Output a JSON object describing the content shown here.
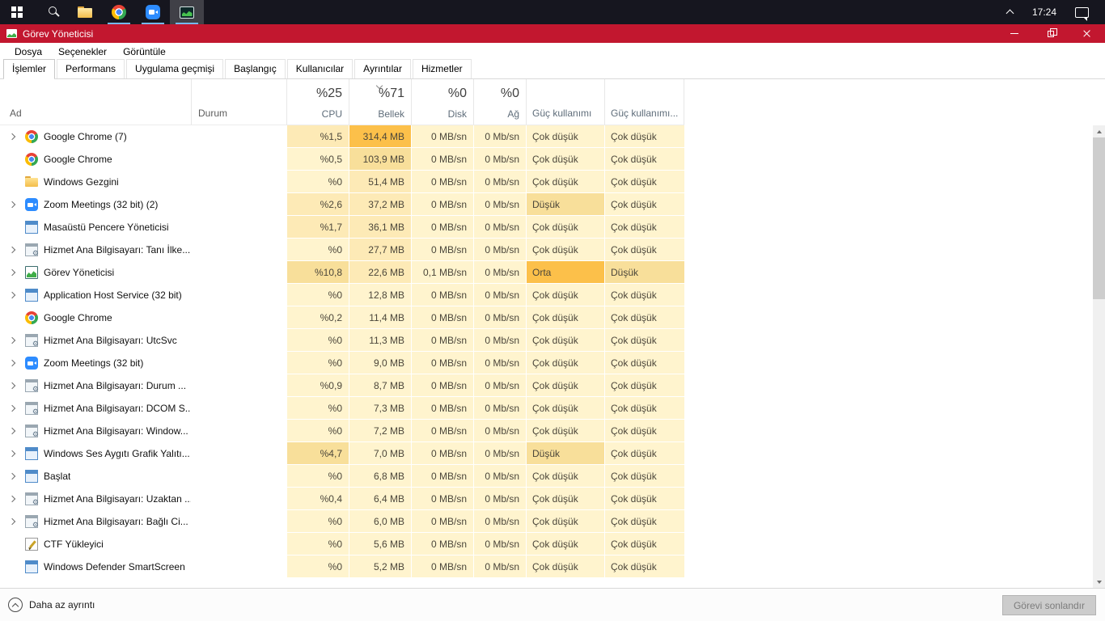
{
  "colors": {
    "taskbar_bg": "#16161f",
    "titlebar_bg": "#c2172f",
    "underline": "#76b9ed",
    "heat": [
      "#fff4ce",
      "#fdeab6",
      "#f8df9a",
      "#f5d172",
      "#fcc04a"
    ]
  },
  "taskbar": {
    "time": "17:24",
    "icons": [
      "start",
      "search",
      "file-explorer",
      "chrome",
      "zoom",
      "task-manager"
    ],
    "active_icon": "task-manager"
  },
  "titlebar": {
    "title": "Görev Yöneticisi"
  },
  "menubar": {
    "items": [
      "Dosya",
      "Seçenekler",
      "Görüntüle"
    ]
  },
  "tabs": {
    "items": [
      "İşlemler",
      "Performans",
      "Uygulama geçmişi",
      "Başlangıç",
      "Kullanıcılar",
      "Ayrıntılar",
      "Hizmetler"
    ],
    "active": "İşlemler"
  },
  "table": {
    "columns": {
      "name": "Ad",
      "status": "Durum",
      "cpu": {
        "pct": "%25",
        "label": "CPU"
      },
      "memory": {
        "pct": "%71",
        "label": "Bellek",
        "sorted": "desc"
      },
      "disk": {
        "pct": "%0",
        "label": "Disk"
      },
      "network": {
        "pct": "%0",
        "label": "Ağ"
      },
      "power": {
        "label": "Güç kullanımı"
      },
      "power_trend": {
        "label": "Güç kullanımı..."
      }
    },
    "rows": [
      {
        "name": "Google Chrome (7)",
        "icon": "chrome",
        "expand": true,
        "status": "",
        "cpu": "%1,5",
        "memory": "314,4 MB",
        "disk": "0 MB/sn",
        "network": "0 Mb/sn",
        "power": "Çok düşük",
        "trend": "Çok düşük",
        "heat": [
          1,
          4,
          0,
          0,
          0,
          0
        ]
      },
      {
        "name": "Google Chrome",
        "icon": "chrome",
        "expand": false,
        "status": "",
        "cpu": "%0,5",
        "memory": "103,9 MB",
        "disk": "0 MB/sn",
        "network": "0 Mb/sn",
        "power": "Çok düşük",
        "trend": "Çok düşük",
        "heat": [
          0,
          2,
          0,
          0,
          0,
          0
        ]
      },
      {
        "name": "Windows Gezgini",
        "icon": "folder",
        "expand": false,
        "status": "",
        "cpu": "%0",
        "memory": "51,4 MB",
        "disk": "0 MB/sn",
        "network": "0 Mb/sn",
        "power": "Çok düşük",
        "trend": "Çok düşük",
        "heat": [
          0,
          1,
          0,
          0,
          0,
          0
        ]
      },
      {
        "name": "Zoom Meetings (32 bit) (2)",
        "icon": "zoom",
        "expand": true,
        "status": "",
        "cpu": "%2,6",
        "memory": "37,2 MB",
        "disk": "0 MB/sn",
        "network": "0 Mb/sn",
        "power": "Düşük",
        "trend": "Çok düşük",
        "heat": [
          1,
          1,
          0,
          0,
          2,
          0
        ]
      },
      {
        "name": "Masaüstü Pencere Yöneticisi",
        "icon": "window",
        "expand": false,
        "status": "",
        "cpu": "%1,7",
        "memory": "36,1 MB",
        "disk": "0 MB/sn",
        "network": "0 Mb/sn",
        "power": "Çok düşük",
        "trend": "Çok düşük",
        "heat": [
          1,
          1,
          0,
          0,
          0,
          0
        ]
      },
      {
        "name": "Hizmet Ana Bilgisayarı: Tanı İlke...",
        "icon": "svchost",
        "expand": true,
        "status": "",
        "cpu": "%0",
        "memory": "27,7 MB",
        "disk": "0 MB/sn",
        "network": "0 Mb/sn",
        "power": "Çok düşük",
        "trend": "Çok düşük",
        "heat": [
          0,
          1,
          0,
          0,
          0,
          0
        ]
      },
      {
        "name": "Görev Yöneticisi",
        "icon": "taskmgr",
        "expand": true,
        "status": "",
        "cpu": "%10,8",
        "memory": "22,6 MB",
        "disk": "0,1 MB/sn",
        "network": "0 Mb/sn",
        "power": "Orta",
        "trend": "Düşük",
        "heat": [
          2,
          1,
          0,
          0,
          4,
          2
        ]
      },
      {
        "name": "Application Host Service (32 bit)",
        "icon": "window",
        "expand": true,
        "status": "",
        "cpu": "%0",
        "memory": "12,8 MB",
        "disk": "0 MB/sn",
        "network": "0 Mb/sn",
        "power": "Çok düşük",
        "trend": "Çok düşük",
        "heat": [
          0,
          0,
          0,
          0,
          0,
          0
        ]
      },
      {
        "name": "Google Chrome",
        "icon": "chrome",
        "expand": false,
        "status": "",
        "cpu": "%0,2",
        "memory": "11,4 MB",
        "disk": "0 MB/sn",
        "network": "0 Mb/sn",
        "power": "Çok düşük",
        "trend": "Çok düşük",
        "heat": [
          0,
          0,
          0,
          0,
          0,
          0
        ]
      },
      {
        "name": "Hizmet Ana Bilgisayarı: UtcSvc",
        "icon": "svchost",
        "expand": true,
        "status": "",
        "cpu": "%0",
        "memory": "11,3 MB",
        "disk": "0 MB/sn",
        "network": "0 Mb/sn",
        "power": "Çok düşük",
        "trend": "Çok düşük",
        "heat": [
          0,
          0,
          0,
          0,
          0,
          0
        ]
      },
      {
        "name": "Zoom Meetings (32 bit)",
        "icon": "zoom",
        "expand": true,
        "status": "",
        "cpu": "%0",
        "memory": "9,0 MB",
        "disk": "0 MB/sn",
        "network": "0 Mb/sn",
        "power": "Çok düşük",
        "trend": "Çok düşük",
        "heat": [
          0,
          0,
          0,
          0,
          0,
          0
        ]
      },
      {
        "name": "Hizmet Ana Bilgisayarı: Durum ...",
        "icon": "svchost",
        "expand": true,
        "status": "",
        "cpu": "%0,9",
        "memory": "8,7 MB",
        "disk": "0 MB/sn",
        "network": "0 Mb/sn",
        "power": "Çok düşük",
        "trend": "Çok düşük",
        "heat": [
          0,
          0,
          0,
          0,
          0,
          0
        ]
      },
      {
        "name": "Hizmet Ana Bilgisayarı: DCOM S...",
        "icon": "svchost",
        "expand": true,
        "status": "",
        "cpu": "%0",
        "memory": "7,3 MB",
        "disk": "0 MB/sn",
        "network": "0 Mb/sn",
        "power": "Çok düşük",
        "trend": "Çok düşük",
        "heat": [
          0,
          0,
          0,
          0,
          0,
          0
        ]
      },
      {
        "name": "Hizmet Ana Bilgisayarı: Window...",
        "icon": "svchost",
        "expand": true,
        "status": "",
        "cpu": "%0",
        "memory": "7,2 MB",
        "disk": "0 MB/sn",
        "network": "0 Mb/sn",
        "power": "Çok düşük",
        "trend": "Çok düşük",
        "heat": [
          0,
          0,
          0,
          0,
          0,
          0
        ]
      },
      {
        "name": "Windows Ses Aygıtı Grafik Yalıtı...",
        "icon": "window",
        "expand": true,
        "status": "",
        "cpu": "%4,7",
        "memory": "7,0 MB",
        "disk": "0 MB/sn",
        "network": "0 Mb/sn",
        "power": "Düşük",
        "trend": "Çok düşük",
        "heat": [
          2,
          0,
          0,
          0,
          2,
          0
        ]
      },
      {
        "name": "Başlat",
        "icon": "window",
        "expand": true,
        "status": "",
        "cpu": "%0",
        "memory": "6,8 MB",
        "disk": "0 MB/sn",
        "network": "0 Mb/sn",
        "power": "Çok düşük",
        "trend": "Çok düşük",
        "heat": [
          0,
          0,
          0,
          0,
          0,
          0
        ]
      },
      {
        "name": "Hizmet Ana Bilgisayarı: Uzaktan ...",
        "icon": "svchost",
        "expand": true,
        "status": "",
        "cpu": "%0,4",
        "memory": "6,4 MB",
        "disk": "0 MB/sn",
        "network": "0 Mb/sn",
        "power": "Çok düşük",
        "trend": "Çok düşük",
        "heat": [
          0,
          0,
          0,
          0,
          0,
          0
        ]
      },
      {
        "name": "Hizmet Ana Bilgisayarı: Bağlı Ci...",
        "icon": "svchost",
        "expand": true,
        "status": "",
        "cpu": "%0",
        "memory": "6,0 MB",
        "disk": "0 MB/sn",
        "network": "0 Mb/sn",
        "power": "Çok düşük",
        "trend": "Çok düşük",
        "heat": [
          0,
          0,
          0,
          0,
          0,
          0
        ]
      },
      {
        "name": "CTF Yükleyici",
        "icon": "ctf",
        "expand": false,
        "status": "",
        "cpu": "%0",
        "memory": "5,6 MB",
        "disk": "0 MB/sn",
        "network": "0 Mb/sn",
        "power": "Çok düşük",
        "trend": "Çok düşük",
        "heat": [
          0,
          0,
          0,
          0,
          0,
          0
        ]
      },
      {
        "name": "Windows Defender SmartScreen",
        "icon": "window",
        "expand": false,
        "status": "",
        "cpu": "%0",
        "memory": "5,2 MB",
        "disk": "0 MB/sn",
        "network": "0 Mb/sn",
        "power": "Çok düşük",
        "trend": "Çok düşük",
        "heat": [
          0,
          0,
          0,
          0,
          0,
          0
        ]
      }
    ]
  },
  "footer": {
    "toggle_label": "Daha az ayrıntı",
    "end_task_label": "Görevi sonlandır"
  }
}
